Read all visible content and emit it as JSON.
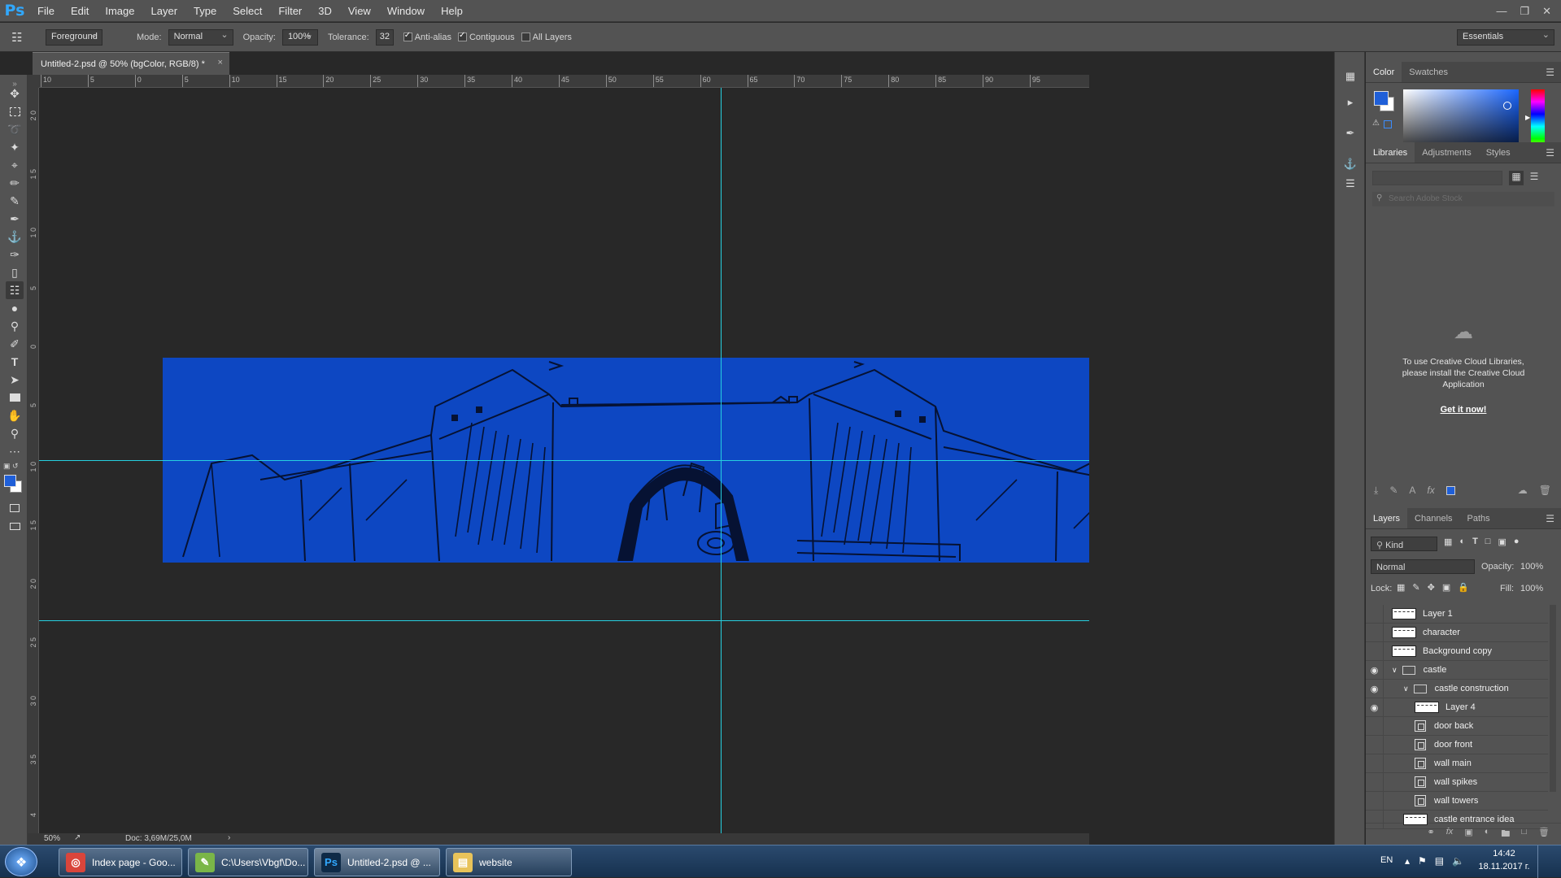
{
  "app": {
    "logo": "Ps",
    "menu": [
      "File",
      "Edit",
      "Image",
      "Layer",
      "Type",
      "Select",
      "Filter",
      "3D",
      "View",
      "Window",
      "Help"
    ],
    "accent": "#31a8ff"
  },
  "options": {
    "fill_source": "Foreground",
    "mode_label": "Mode:",
    "mode_value": "Normal",
    "opacity_label": "Opacity:",
    "opacity_value": "100%",
    "tolerance_label": "Tolerance:",
    "tolerance_value": "32",
    "antialias_label": "Anti-alias",
    "contiguous_label": "Contiguous",
    "all_layers_label": "All Layers",
    "antialias_checked": true,
    "contiguous_checked": true,
    "all_layers_checked": false,
    "workspace": "Essentials"
  },
  "document": {
    "tab_title": "Untitled-2.psd @ 50% (bgColor, RGB/8) *",
    "close": "×",
    "image_color": "#0d47c2",
    "guide_color": "#26d0e0"
  },
  "rulers": {
    "top_labels": [
      "10",
      "5",
      "0",
      "5",
      "10",
      "15",
      "20",
      "25",
      "30",
      "35",
      "40",
      "45",
      "50",
      "55",
      "60",
      "65",
      "70",
      "75",
      "80",
      "85",
      "90",
      "95"
    ],
    "left_labels": [
      "2 0",
      "1 5",
      "1 0",
      "5",
      "0",
      "5",
      "1 0",
      "1 5",
      "2 0",
      "2 5",
      "3 0",
      "3 5",
      "4"
    ]
  },
  "status": {
    "zoom": "50%",
    "doc_info": "Doc: 3,69M/25,0M",
    "arrow": "›"
  },
  "color_panel": {
    "tabs": [
      "Color",
      "Swatches"
    ],
    "foreground": "#1f5fd8",
    "background": "#ffffff"
  },
  "libraries_panel": {
    "tabs": [
      "Libraries",
      "Adjustments",
      "Styles"
    ],
    "search_placeholder": "Search Adobe Stock",
    "message": "To use Creative Cloud Libraries, please install the Creative Cloud Application",
    "link": "Get it now!"
  },
  "layers_panel": {
    "tabs": [
      "Layers",
      "Channels",
      "Paths"
    ],
    "filter": "Kind",
    "blend_mode": "Normal",
    "opacity_label": "Opacity:",
    "opacity_value": "100%",
    "lock_label": "Lock:",
    "fill_label": "Fill:",
    "fill_value": "100%",
    "layers": [
      {
        "name": "Layer 1",
        "kind": "pixel",
        "visible": false,
        "indent": 0
      },
      {
        "name": "character",
        "kind": "pixel",
        "visible": false,
        "indent": 0
      },
      {
        "name": "Background copy",
        "kind": "pixel",
        "visible": false,
        "indent": 0
      },
      {
        "name": "castle",
        "kind": "group",
        "visible": true,
        "indent": 0
      },
      {
        "name": "castle construction",
        "kind": "group",
        "visible": true,
        "indent": 1
      },
      {
        "name": "Layer 4",
        "kind": "pixel",
        "visible": true,
        "indent": 2
      },
      {
        "name": "door back",
        "kind": "smart",
        "visible": false,
        "indent": 2
      },
      {
        "name": "door front",
        "kind": "smart",
        "visible": false,
        "indent": 2
      },
      {
        "name": "wall main",
        "kind": "smart",
        "visible": false,
        "indent": 2
      },
      {
        "name": "wall spikes",
        "kind": "smart",
        "visible": false,
        "indent": 2
      },
      {
        "name": "wall towers",
        "kind": "smart",
        "visible": false,
        "indent": 2
      },
      {
        "name": "castle entrance idea",
        "kind": "pixel",
        "visible": false,
        "indent": 1
      }
    ]
  },
  "taskbar": {
    "items": [
      {
        "label": "Index page - Goo...",
        "icon": "chrome-icon"
      },
      {
        "label": "C:\\Users\\Vbgf\\Do...",
        "icon": "notepad-icon"
      },
      {
        "label": "Untitled-2.psd @ ...",
        "icon": "photoshop-icon"
      },
      {
        "label": "website",
        "icon": "folder-icon"
      }
    ],
    "lang": "EN",
    "time": "14:42",
    "date": "18.11.2017 г."
  }
}
